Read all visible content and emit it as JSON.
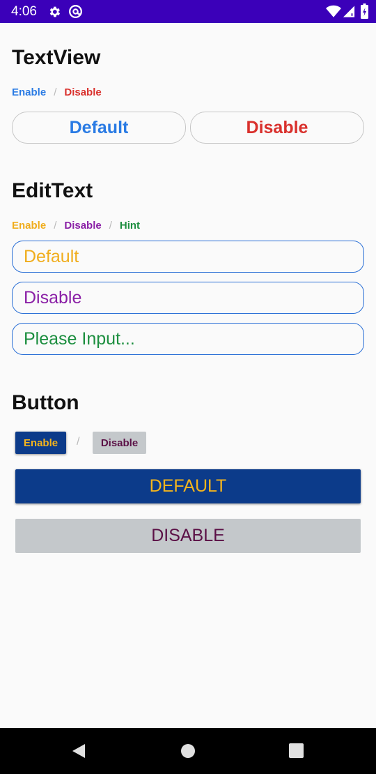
{
  "status_bar": {
    "time": "4:06",
    "icons": [
      "gear-icon",
      "at-icon",
      "wifi-icon",
      "signal-icon",
      "battery-icon"
    ]
  },
  "textview": {
    "title": "TextView",
    "legend_enable": "Enable",
    "legend_sep": "/",
    "legend_disable": "Disable",
    "default_label": "Default",
    "disable_label": "Disable"
  },
  "edittext": {
    "title": "EditText",
    "legend_enable": "Enable",
    "legend_sep": "/",
    "legend_disable": "Disable",
    "legend_hint": "Hint",
    "field_default_value": "Default",
    "field_disable_value": "Disable",
    "field_hint_placeholder": "Please Input..."
  },
  "button": {
    "title": "Button",
    "enable_small_label": "Enable",
    "sep": "/",
    "disable_small_label": "Disable",
    "default_label": "DEFAULT",
    "disable_label": "DISABLE"
  },
  "colors": {
    "status_bar": "#3b00b9",
    "textview_enable": "#2a7be4",
    "textview_disable": "#d9302c",
    "edittext_enable": "#f0ad1c",
    "edittext_disable": "#8a1fa6",
    "edittext_hint": "#1c8e3f",
    "edittext_border": "#2a6fd6",
    "button_enable_bg": "#0c3b8a",
    "button_enable_text": "#f5b51c",
    "button_disable_bg": "#c4c8cb",
    "button_disable_text": "#5b1046"
  },
  "nav_bar": {
    "icons": [
      "back-icon",
      "home-icon",
      "recents-icon"
    ]
  }
}
